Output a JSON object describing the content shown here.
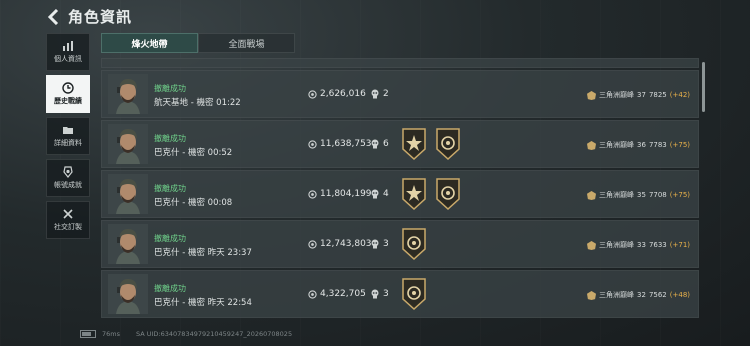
{
  "header": {
    "title": "角色資訊"
  },
  "sidebar": {
    "items": [
      {
        "label": "個人資訊",
        "icon": "bar-chart-icon"
      },
      {
        "label": "歷史戰績",
        "icon": "history-clock-icon",
        "active": true
      },
      {
        "label": "詳細資料",
        "icon": "folder-icon"
      },
      {
        "label": "帳號成就",
        "icon": "achievement-badge-icon"
      },
      {
        "label": "社交訂製",
        "icon": "tools-icon"
      }
    ]
  },
  "tabs": [
    {
      "label": "烽火地帶",
      "active": true
    },
    {
      "label": "全面戰場",
      "active": false
    }
  ],
  "matches": [
    {
      "status": "撤離成功",
      "place": "航天基地 - 機密 01:22",
      "money": "2,626,016",
      "kills": "2",
      "medals": [],
      "rank_name": "三角洲巔峰",
      "rank_level": "37",
      "rank_score": "7825",
      "rank_delta": "(+42)"
    },
    {
      "status": "撤離成功",
      "place": "巴克什 - 機密 00:52",
      "money": "11,638,753",
      "kills": "6",
      "medals": [
        "star-medal-icon",
        "target-medal-icon"
      ],
      "rank_name": "三角洲巔峰",
      "rank_level": "36",
      "rank_score": "7783",
      "rank_delta": "(+75)"
    },
    {
      "status": "撤離成功",
      "place": "巴克什 - 機密 00:08",
      "money": "11,804,199",
      "kills": "4",
      "medals": [
        "star-medal-icon",
        "target-medal-icon"
      ],
      "rank_name": "三角洲巔峰",
      "rank_level": "35",
      "rank_score": "7708",
      "rank_delta": "(+75)"
    },
    {
      "status": "撤離成功",
      "place": "巴克什 - 機密 昨天 23:37",
      "money": "12,743,803",
      "kills": "3",
      "medals": [
        "target-medal-icon"
      ],
      "rank_name": "三角洲巔峰",
      "rank_level": "33",
      "rank_score": "7633",
      "rank_delta": "(+71)"
    },
    {
      "status": "撤離成功",
      "place": "巴克什 - 機密 昨天 22:54",
      "money": "4,322,705",
      "kills": "3",
      "medals": [
        "target-medal-icon"
      ],
      "rank_name": "三角洲巔峰",
      "rank_level": "32",
      "rank_score": "7562",
      "rank_delta": "(+48)"
    }
  ],
  "footer": {
    "ping": "76ms",
    "uid": "SA UID:6340783497921045924​7_20260708025"
  },
  "colors": {
    "accent_green": "#6fd08a",
    "tab_active": "#2e4a47",
    "rank_plus": "#e8b04a",
    "medal_gold": "#c9a96a"
  }
}
